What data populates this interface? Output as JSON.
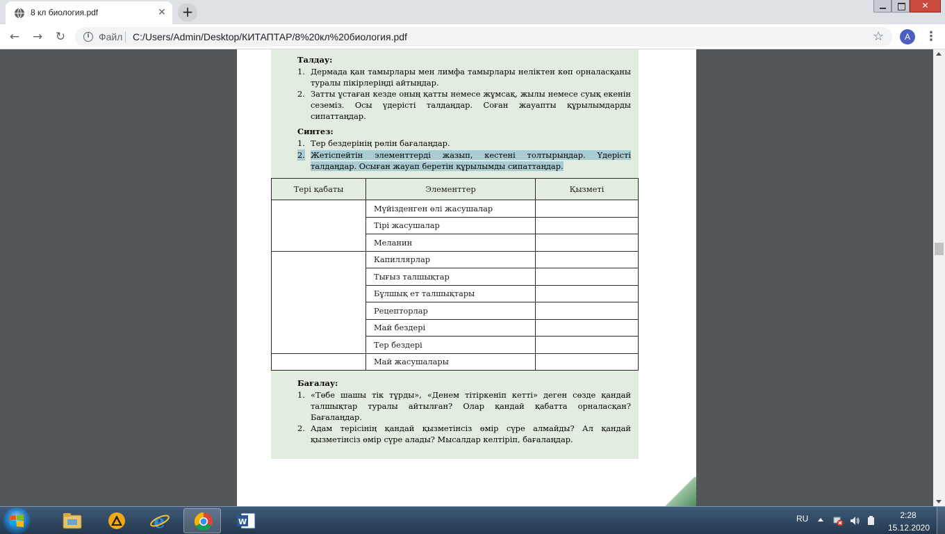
{
  "browser": {
    "tab_title": "8 кл биология.pdf",
    "scheme_label": "Файл",
    "url": "C:/Users/Admin/Desktop/КИТАПТАР/8%20кл%20биология.pdf",
    "avatar_letter": "A",
    "icons": {
      "back": "arrow-left-icon",
      "forward": "arrow-right-icon",
      "reload": "reload-icon",
      "info": "info-icon",
      "star": "star-icon",
      "menu": "kebab-menu-icon",
      "new_tab": "plus-icon",
      "close_tab": "close-icon"
    }
  },
  "document": {
    "analysis": {
      "title": "Талдау:",
      "items": [
        {
          "num": "1.",
          "text": "Дермада қан тамырлары мен лимфа тамырлары неліктен көп орналасқаны туралы пікірлеріңді айтыңдар."
        },
        {
          "num": "2.",
          "text": "Затты ұстаған кезде оның қатты немесе жұмсақ, жылы немесе суық екенін сеземіз. Осы үдерісті талдаңдар. Соған жауапты құрылымдарды сипаттаңдар."
        }
      ]
    },
    "synthesis": {
      "title": "Синтез:",
      "items": [
        {
          "num": "1.",
          "text": "Тер бездерінің рөлін бағалаңдар."
        },
        {
          "num": "2.",
          "text": "Жетіспейтін элементтерді жазып, кестені толтырыңдар. Үдерісті талдаңдар. Осыған жауап беретін құрылымды сипаттаңдар."
        }
      ]
    },
    "table": {
      "headers": [
        "Тері қабаты",
        "Элементтер",
        "Қызметі"
      ],
      "rows": [
        "Мүйізденген өлі жасушалар",
        "Тірі жасушалар",
        "Меланин",
        "Капиллярлар",
        "Тығыз талшықтар",
        "Бұлшық ет талшықтары",
        "Рецепторлар",
        "Май бездері",
        "Тер бездері",
        "Май жасушалары"
      ]
    },
    "evaluation": {
      "title": "Бағалау:",
      "items": [
        {
          "num": "1.",
          "text": "«Төбе шашы тік тұрды», «Денем тітіркеніп кетті» деген сөзде қандай талшықтар туралы айтылған? Олар қандай қабатта орналасқан? Бағалаңдар."
        },
        {
          "num": "2.",
          "text": "Адам терісінің қандай қызметінсіз өмір сүре алмайды? Ал қандай қызметінсіз өмір сүре алады? Мысалдар келтіріп, бағалаңдар."
        }
      ]
    }
  },
  "taskbar": {
    "language": "RU",
    "time": "2:28",
    "date": "15.12.2020",
    "apps": [
      "explorer-icon",
      "aimp-icon",
      "internet-explorer-icon",
      "chrome-icon",
      "word-icon"
    ]
  },
  "colors": {
    "panel_green": "#e3eddf",
    "highlight": "#a9cbd3",
    "viewer_bg": "#525659"
  }
}
